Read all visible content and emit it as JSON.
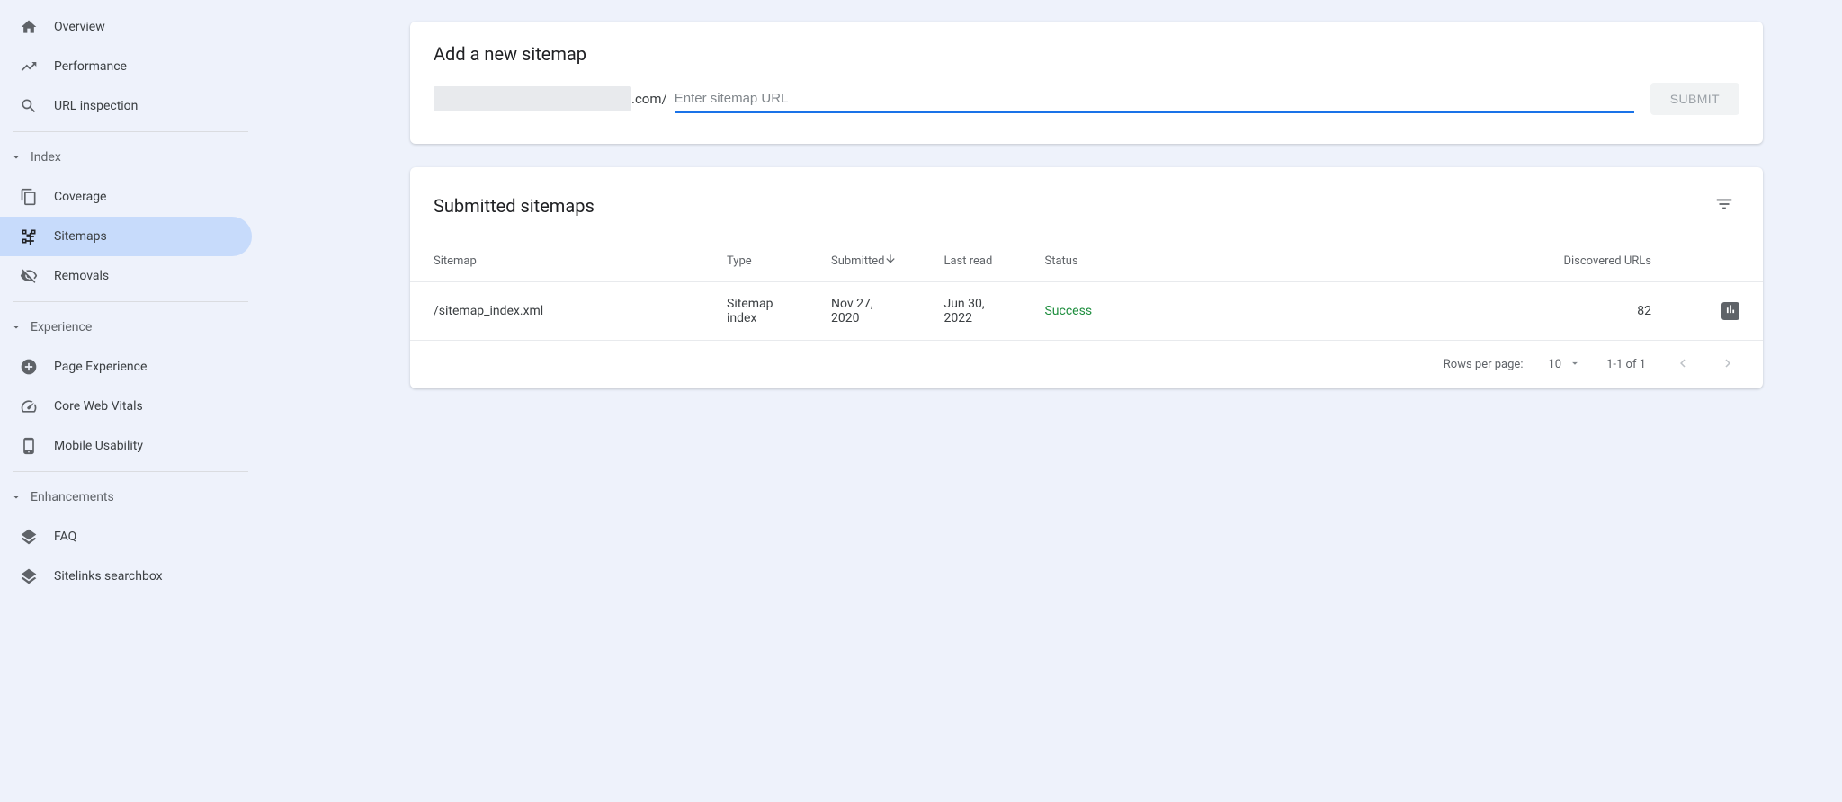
{
  "sidebar": {
    "top": [
      {
        "label": "Overview",
        "icon": "home"
      },
      {
        "label": "Performance",
        "icon": "trend"
      },
      {
        "label": "URL inspection",
        "icon": "search"
      }
    ],
    "sections": [
      {
        "title": "Index",
        "items": [
          {
            "label": "Coverage",
            "icon": "copy"
          },
          {
            "label": "Sitemaps",
            "icon": "sitemap",
            "active": true
          },
          {
            "label": "Removals",
            "icon": "hide"
          }
        ]
      },
      {
        "title": "Experience",
        "items": [
          {
            "label": "Page Experience",
            "icon": "circle-plus"
          },
          {
            "label": "Core Web Vitals",
            "icon": "speed"
          },
          {
            "label": "Mobile Usability",
            "icon": "phone"
          }
        ]
      },
      {
        "title": "Enhancements",
        "items": [
          {
            "label": "FAQ",
            "icon": "layers"
          },
          {
            "label": "Sitelinks searchbox",
            "icon": "layers"
          }
        ]
      }
    ]
  },
  "add_card": {
    "title": "Add a new sitemap",
    "domain_suffix": ".com/",
    "input_placeholder": "Enter sitemap URL",
    "submit_label": "SUBMIT"
  },
  "list_card": {
    "title": "Submitted sitemaps",
    "columns": {
      "sitemap": "Sitemap",
      "type": "Type",
      "submitted": "Submitted",
      "last_read": "Last read",
      "status": "Status",
      "discovered": "Discovered URLs"
    },
    "rows": [
      {
        "sitemap": "/sitemap_index.xml",
        "type": "Sitemap index",
        "submitted": "Nov 27, 2020",
        "last_read": "Jun 30, 2022",
        "status": "Success",
        "discovered": "82"
      }
    ],
    "pager": {
      "rows_label": "Rows per page:",
      "rows_value": "10",
      "range": "1-1 of 1"
    }
  }
}
